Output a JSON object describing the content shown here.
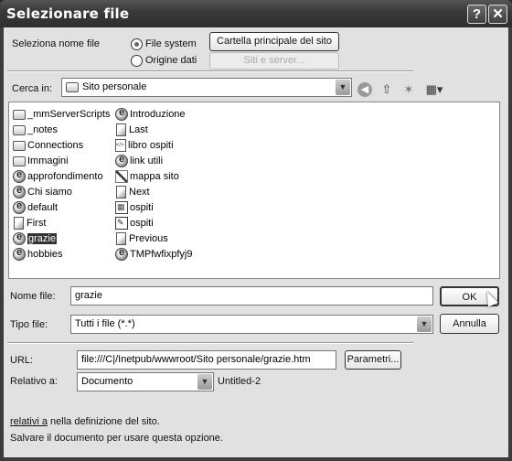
{
  "window": {
    "title": "Selezionare file",
    "help_label": "?",
    "close_label": "✕"
  },
  "select_source": {
    "label": "Seleziona nome file",
    "options": [
      {
        "label": "File system",
        "checked": true
      },
      {
        "label": "Origine dati",
        "checked": false
      }
    ],
    "site_root_button": "Cartella principale del sito",
    "sites_servers_button": "Siti e server..."
  },
  "look_in": {
    "label": "Cerca in:",
    "value": "Sito personale",
    "toolbar_icons": [
      "back-icon",
      "up-folder-icon",
      "new-folder-icon",
      "view-menu-icon"
    ]
  },
  "files": {
    "column1": [
      {
        "name": "_mmServerScripts",
        "icon": "folder"
      },
      {
        "name": "_notes",
        "icon": "folder"
      },
      {
        "name": "Connections",
        "icon": "folder"
      },
      {
        "name": "Immagini",
        "icon": "folder"
      },
      {
        "name": "approfondimento",
        "icon": "ie"
      },
      {
        "name": "Chi siamo",
        "icon": "ie"
      },
      {
        "name": "default",
        "icon": "ie"
      },
      {
        "name": "First",
        "icon": "doc"
      },
      {
        "name": "grazie",
        "icon": "ie",
        "selected": true
      },
      {
        "name": "hobbies",
        "icon": "ie"
      }
    ],
    "column2": [
      {
        "name": "Introduzione",
        "icon": "ie"
      },
      {
        "name": "Last",
        "icon": "doc"
      },
      {
        "name": "libro ospiti",
        "icon": "code"
      },
      {
        "name": "link utili",
        "icon": "ie"
      },
      {
        "name": "mappa sito",
        "icon": "map"
      },
      {
        "name": "Next",
        "icon": "doc"
      },
      {
        "name": "ospiti",
        "icon": "form"
      },
      {
        "name": "ospiti",
        "icon": "script"
      },
      {
        "name": "Previous",
        "icon": "doc"
      },
      {
        "name": "TMPfwfixpfyj9",
        "icon": "ie"
      }
    ]
  },
  "filename": {
    "label": "Nome file:",
    "value": "grazie"
  },
  "filetype": {
    "label": "Tipo file:",
    "value": "Tutti i file (*.*)"
  },
  "buttons": {
    "ok": "OK",
    "cancel": "Annulla",
    "params": "Parametri..."
  },
  "url": {
    "label": "URL:",
    "value": "file:///C|/Inetpub/wwwroot/Sito personale/grazie.htm"
  },
  "relative": {
    "label": "Relativo a:",
    "value": "Documento",
    "doc_name": "Untitled-2"
  },
  "footer": {
    "link": "relativi a",
    "line1_rest": " nella definizione del sito.",
    "line2": "Salvare il documento per usare questa opzione."
  }
}
